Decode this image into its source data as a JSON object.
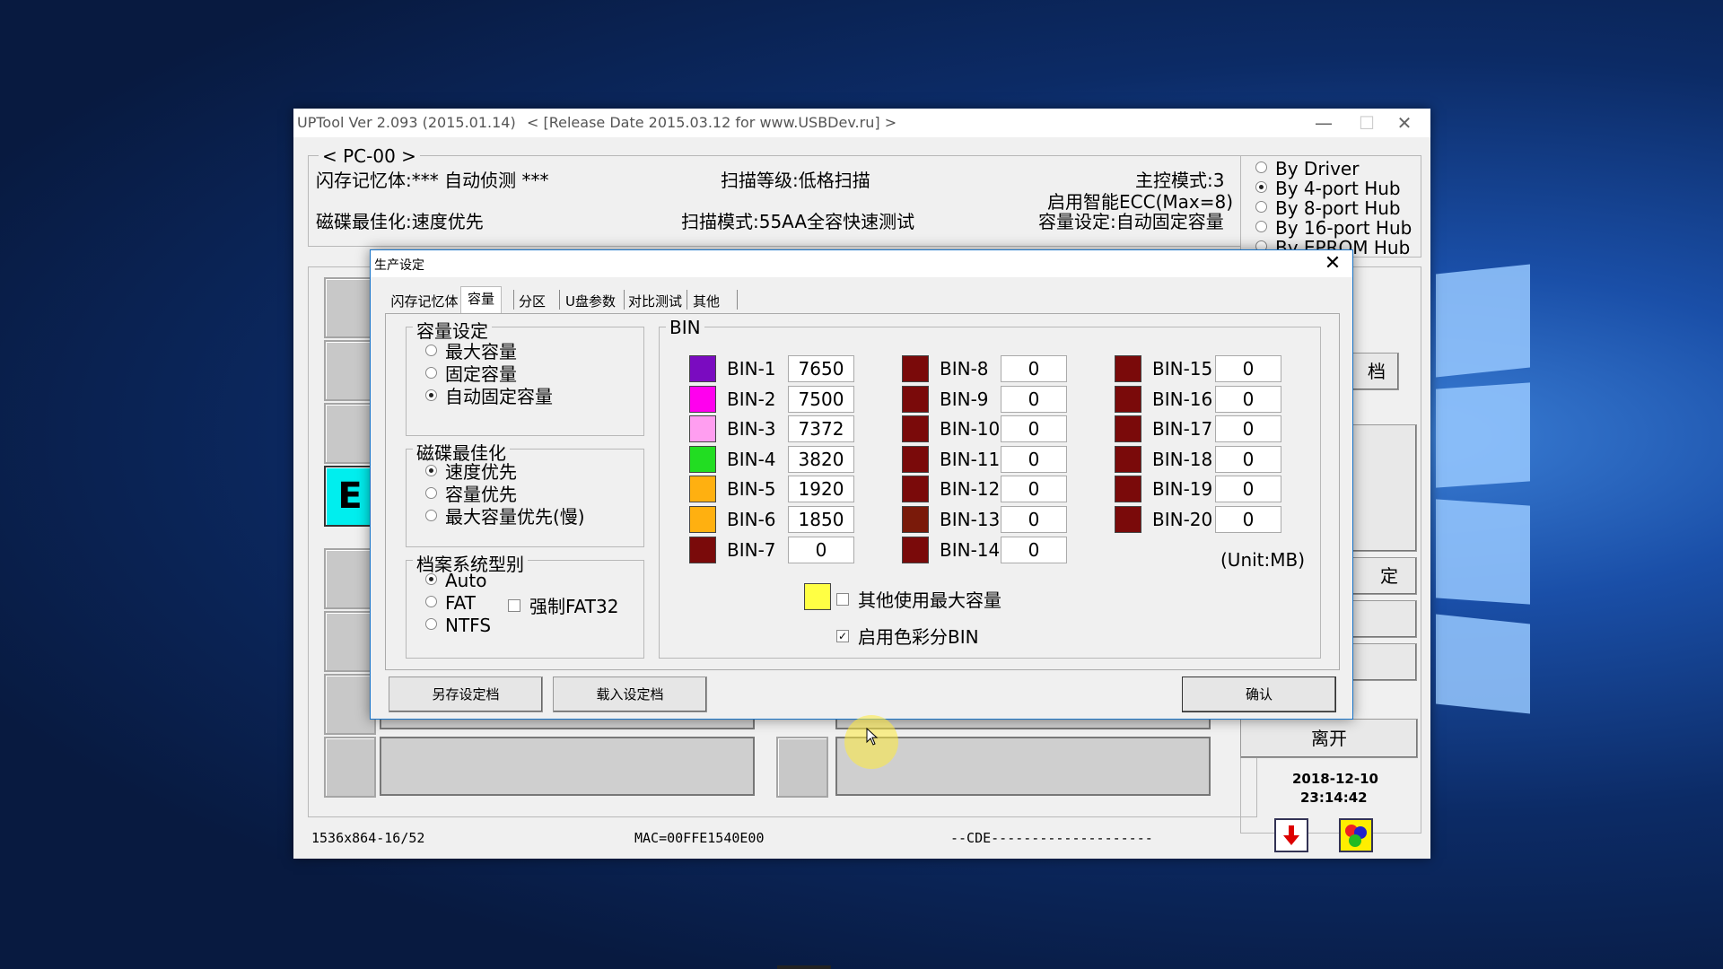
{
  "colors": {
    "desktop_bg": "#0c2b66",
    "accent": "#1873c7"
  },
  "main": {
    "title": "UPTool Ver 2.093 (2015.01.14)",
    "release": "< [Release Date 2015.03.12 for www.USBDev.ru] >",
    "minimize": "—",
    "maximize": "☐",
    "close": "✕",
    "pc": "< PC-00 >",
    "flash": "闪存记忆体:*** 自动侦测 ***",
    "scan_level": "扫描等级:低格扫描",
    "ctrl_mode": "主控模式:3",
    "ecc": "启用智能ECC(Max=8)",
    "disk_opt": "磁碟最佳化:速度优先",
    "scan_mode": "扫描模式:55AA全容快速测试",
    "cap_setting": "容量设定:自动固定容量",
    "hub_options": [
      "By Driver",
      "By 4-port Hub",
      "By 8-port Hub",
      "By 16-port Hub",
      "By EPROM Hub"
    ],
    "hub_selected": "By 4-port Hub",
    "port_letter": "E",
    "side_labels": {
      "btn1": "档",
      "btn2": "定",
      "exit": "离开"
    },
    "date": "2018-12-10",
    "time": "23:14:42",
    "status_left": "1536x864-16/52",
    "status_mac": "MAC=00FFE1540E00",
    "status_cde": "--CDE--------------------"
  },
  "dialog": {
    "title": "生产设定",
    "close": "✕",
    "tabs": [
      "闪存记忆体",
      "容量",
      "分区",
      "U盘参数",
      "对比测试",
      "其他"
    ],
    "active_tab": "容量",
    "capacity": {
      "title": "容量设定",
      "options": [
        "最大容量",
        "固定容量",
        "自动固定容量"
      ],
      "selected": "自动固定容量"
    },
    "disk_opt": {
      "title": "磁碟最佳化",
      "options": [
        "速度优先",
        "容量优先",
        "最大容量优先(慢)"
      ],
      "selected": "速度优先"
    },
    "fs": {
      "title": "档案系统型别",
      "auto": "Auto",
      "fat": "FAT",
      "ntfs": "NTFS",
      "force_fat32": "强制FAT32",
      "selected": "Auto"
    },
    "bin": {
      "title": "BIN",
      "unit": "(Unit:MB)",
      "items": [
        {
          "label": "BIN-1",
          "value": "7650",
          "color": "#7a0bc0"
        },
        {
          "label": "BIN-2",
          "value": "7500",
          "color": "#ff00ee"
        },
        {
          "label": "BIN-3",
          "value": "7372",
          "color": "#ff9ef0"
        },
        {
          "label": "BIN-4",
          "value": "3820",
          "color": "#22dd22"
        },
        {
          "label": "BIN-5",
          "value": "1920",
          "color": "#ffb010"
        },
        {
          "label": "BIN-6",
          "value": "1850",
          "color": "#ffb010"
        },
        {
          "label": "BIN-7",
          "value": "0",
          "color": "#7a0a0a"
        },
        {
          "label": "BIN-8",
          "value": "0",
          "color": "#7a0a0a"
        },
        {
          "label": "BIN-9",
          "value": "0",
          "color": "#7a0a0a"
        },
        {
          "label": "BIN-10",
          "value": "0",
          "color": "#7a0a0a"
        },
        {
          "label": "BIN-11",
          "value": "0",
          "color": "#7a0a0a"
        },
        {
          "label": "BIN-12",
          "value": "0",
          "color": "#7a0a0a"
        },
        {
          "label": "BIN-13",
          "value": "0",
          "color": "#7a1a0a"
        },
        {
          "label": "BIN-14",
          "value": "0",
          "color": "#7a0a0a"
        },
        {
          "label": "BIN-15",
          "value": "0",
          "color": "#7a0a0a"
        },
        {
          "label": "BIN-16",
          "value": "0",
          "color": "#7a0a0a"
        },
        {
          "label": "BIN-17",
          "value": "0",
          "color": "#7a0a0a"
        },
        {
          "label": "BIN-18",
          "value": "0",
          "color": "#7a0a0a"
        },
        {
          "label": "BIN-19",
          "value": "0",
          "color": "#7a0a0a"
        },
        {
          "label": "BIN-20",
          "value": "0",
          "color": "#7a0a0a"
        }
      ],
      "other_max": "其他使用最大容量",
      "other_color": "#ffff44",
      "enable_color": "启用色彩分BIN"
    },
    "buttons": {
      "save": "另存设定档",
      "load": "载入设定档",
      "ok": "确认"
    }
  }
}
